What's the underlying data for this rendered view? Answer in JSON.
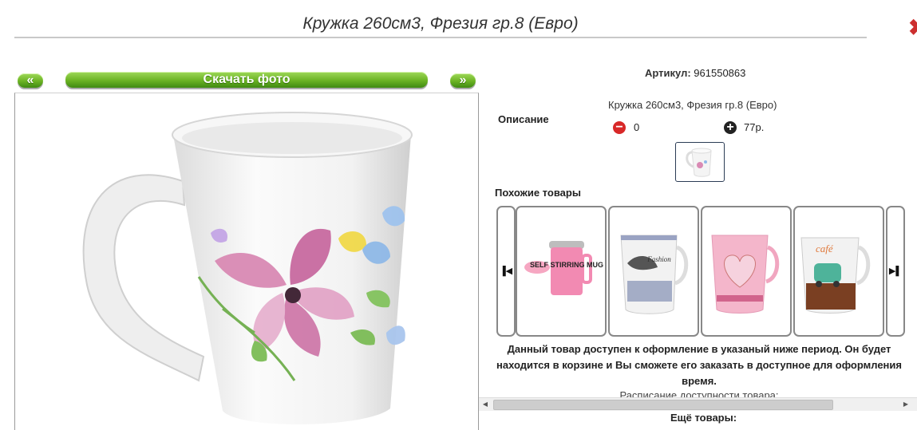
{
  "header": {
    "title": "Кружка 260см3, Фрезия гр.8 (Евро)"
  },
  "gallery": {
    "prev_label": "«",
    "next_label": "»",
    "download_label": "Скачать фото"
  },
  "product": {
    "article_label": "Артикул:",
    "article_value": "961550863",
    "description_label": "Описание",
    "description_text": "Кружка 260см3, Фрезия гр.8 (Евро)",
    "quantity": "0",
    "price": "77р."
  },
  "similar": {
    "title": "Похожие товары",
    "prev_icon": "▐◀",
    "next_icon": "▶▌",
    "items": [
      {
        "text": "SELF STIRRING MUG"
      },
      {
        "text": "Fashion"
      },
      {
        "text": ""
      },
      {
        "text": "café"
      }
    ]
  },
  "notice": {
    "text": "Данный товар доступен к оформление в указаный ниже период. Он будет находится в корзине и Вы сможете его заказать в доступное для оформления время.",
    "schedule": "Расписание доступности товара:"
  },
  "more_label": "Ещё товары:",
  "colors": {
    "accent_green": "#6bb323",
    "minus_red": "#d82828",
    "brand_red": "#cc2f2f"
  }
}
